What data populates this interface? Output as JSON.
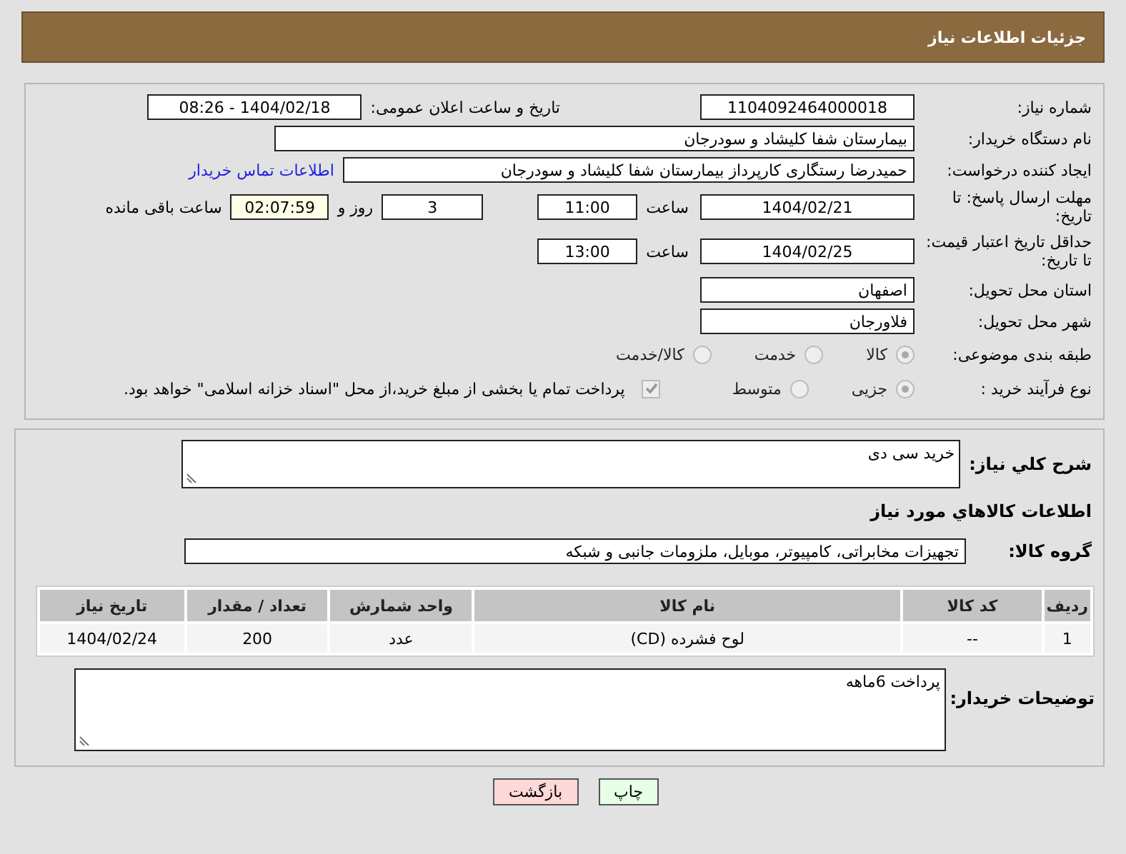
{
  "header": {
    "title": "جزئیات اطلاعات نیاز"
  },
  "details": {
    "need_number": {
      "label": "شماره نیاز:",
      "value": "1104092464000018"
    },
    "announce": {
      "label": "تاریخ و ساعت اعلان عمومی:",
      "value": "1404/02/18 - 08:26"
    },
    "buyer_org": {
      "label": "نام دستگاه خریدار:",
      "value": "بیمارستان شفا کلیشاد و سودرجان"
    },
    "requester": {
      "label": "ایجاد کننده درخواست:",
      "value": "حمیدرضا رستگاری کارپرداز بیمارستان شفا کلیشاد و سودرجان",
      "link": "اطلاعات تماس خریدار"
    },
    "deadline": {
      "label": "مهلت ارسال پاسخ: تا تاریخ:",
      "date": "1404/02/21",
      "time_label": "ساعت",
      "time": "11:00",
      "days": "3",
      "days_label": "روز و",
      "remaining": "02:07:59",
      "remaining_label": "ساعت باقی مانده"
    },
    "price_validity": {
      "label": "حداقل تاریخ اعتبار قیمت: تا تاریخ:",
      "date": "1404/02/25",
      "time_label": "ساعت",
      "time": "13:00"
    },
    "province": {
      "label": "استان محل تحویل:",
      "value": "اصفهان"
    },
    "city": {
      "label": "شهر محل تحویل:",
      "value": "فلاورجان"
    },
    "category": {
      "label": "طبقه بندی موضوعی:",
      "options": [
        {
          "label": "کالا",
          "selected": true
        },
        {
          "label": "خدمت",
          "selected": false
        },
        {
          "label": "کالا/خدمت",
          "selected": false
        }
      ]
    },
    "process": {
      "label": "نوع فرآیند خرید :",
      "options": [
        {
          "label": "جزیی",
          "selected": true
        },
        {
          "label": "متوسط",
          "selected": false
        }
      ],
      "treasury": {
        "label": "پرداخت تمام یا بخشی از مبلغ خرید،از محل \"اسناد خزانه اسلامی\" خواهد بود.",
        "checked": true
      }
    }
  },
  "goods": {
    "description": {
      "label": "شرح کلي نياز:",
      "value": "خرید سی دی"
    },
    "heading": "اطلاعات کالاهاي مورد نياز",
    "group": {
      "label": "گروه کالا:",
      "value": "تجهیزات مخابراتی، کامپیوتر، موبایل، ملزومات جانبی و شبکه"
    },
    "table": {
      "columns": [
        "ردیف",
        "کد کالا",
        "نام کالا",
        "واحد شمارش",
        "تعداد / مقدار",
        "تاریخ نیاز"
      ],
      "rows": [
        [
          "1",
          "--",
          "لوح فشرده (CD)",
          "عدد",
          "200",
          "1404/02/24"
        ]
      ]
    },
    "buyer_notes": {
      "label": "توضیحات خریدار:",
      "value": "پرداخت 6ماهه"
    }
  },
  "buttons": [
    {
      "label": "چاپ",
      "kind": "print"
    },
    {
      "label": "بازگشت",
      "kind": "back"
    }
  ]
}
